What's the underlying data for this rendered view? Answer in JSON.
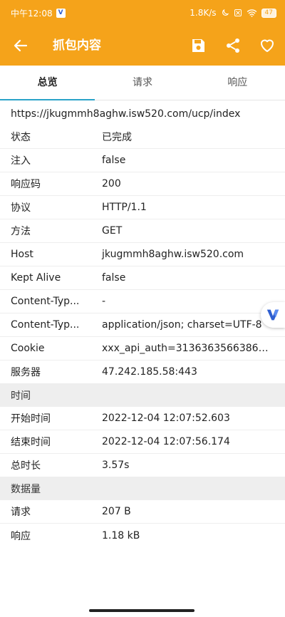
{
  "status_bar": {
    "time": "中午12:08",
    "vpn_icon": "V",
    "net_speed": "1.8K/s",
    "battery": "47"
  },
  "app_bar": {
    "title": "抓包内容",
    "back_icon": "arrow-left",
    "save_icon": "floppy",
    "share_icon": "share",
    "favorite_icon": "heart",
    "color": "#f5a31a"
  },
  "tabs": [
    {
      "label": "总览",
      "active": true
    },
    {
      "label": "请求",
      "active": false
    },
    {
      "label": "响应",
      "active": false
    }
  ],
  "url": "https://jkugmmh8aghw.isw520.com/ucp/index",
  "overview": [
    {
      "key": "状态",
      "value": "已完成"
    },
    {
      "key": "注入",
      "value": "false"
    },
    {
      "key": "响应码",
      "value": "200"
    },
    {
      "key": "协议",
      "value": "HTTP/1.1"
    },
    {
      "key": "方法",
      "value": "GET"
    },
    {
      "key": "Host",
      "value": "jkugmmh8aghw.isw520.com"
    },
    {
      "key": "Kept Alive",
      "value": "false"
    },
    {
      "key": "Content-Typ...",
      "value": "-"
    },
    {
      "key": "Content-Typ...",
      "value": "application/json; charset=UTF-8"
    },
    {
      "key": "Cookie",
      "value": "xxx_api_auth=313636356638636..."
    },
    {
      "key": "服务器",
      "value": "47.242.185.58:443"
    }
  ],
  "time_section": {
    "title": "时间",
    "rows": [
      {
        "key": "开始时间",
        "value": "2022-12-04 12:07:52.603"
      },
      {
        "key": "结束时间",
        "value": "2022-12-04 12:07:56.174"
      },
      {
        "key": "总时长",
        "value": "3.57s"
      }
    ]
  },
  "size_section": {
    "title": "数据量",
    "rows": [
      {
        "key": "请求",
        "value": "207 B"
      },
      {
        "key": "响应",
        "value": "1.18 kB"
      }
    ]
  },
  "floating_button": {
    "icon": "v-logo"
  }
}
